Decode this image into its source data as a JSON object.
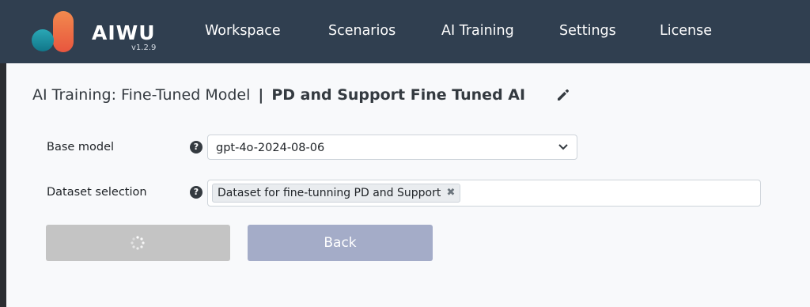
{
  "header": {
    "brand": "AIWU",
    "version": "v1.2.9",
    "nav": [
      "Workspace",
      "Scenarios",
      "AI Training",
      "Settings",
      "License"
    ]
  },
  "page": {
    "title_prefix": "AI Training: Fine-Tuned Model",
    "separator": "|",
    "model_name": "PD and Support Fine Tuned AI"
  },
  "form": {
    "base_model_label": "Base model",
    "base_model_value": "gpt-4o-2024-08-06",
    "dataset_label": "Dataset selection",
    "dataset_selected": [
      "Dataset for fine-tunning PD and Support"
    ],
    "help_glyph": "?",
    "remove_glyph": "✖"
  },
  "buttons": {
    "back_label": "Back"
  },
  "icons": {
    "logo": "aiwu-logo-icon",
    "edit": "pencil-icon",
    "help": "question-circle-icon",
    "chevron": "chevron-down-icon",
    "spinner": "spinner-icon",
    "remove": "close-icon"
  },
  "colors": {
    "navbar": "#303f50",
    "content_bg": "#f8f9fb",
    "back_button": "#a4acc8",
    "loading_button": "#c4c4c4",
    "logo_teal": "#1e8fa0",
    "logo_orange": "#f0784a"
  }
}
